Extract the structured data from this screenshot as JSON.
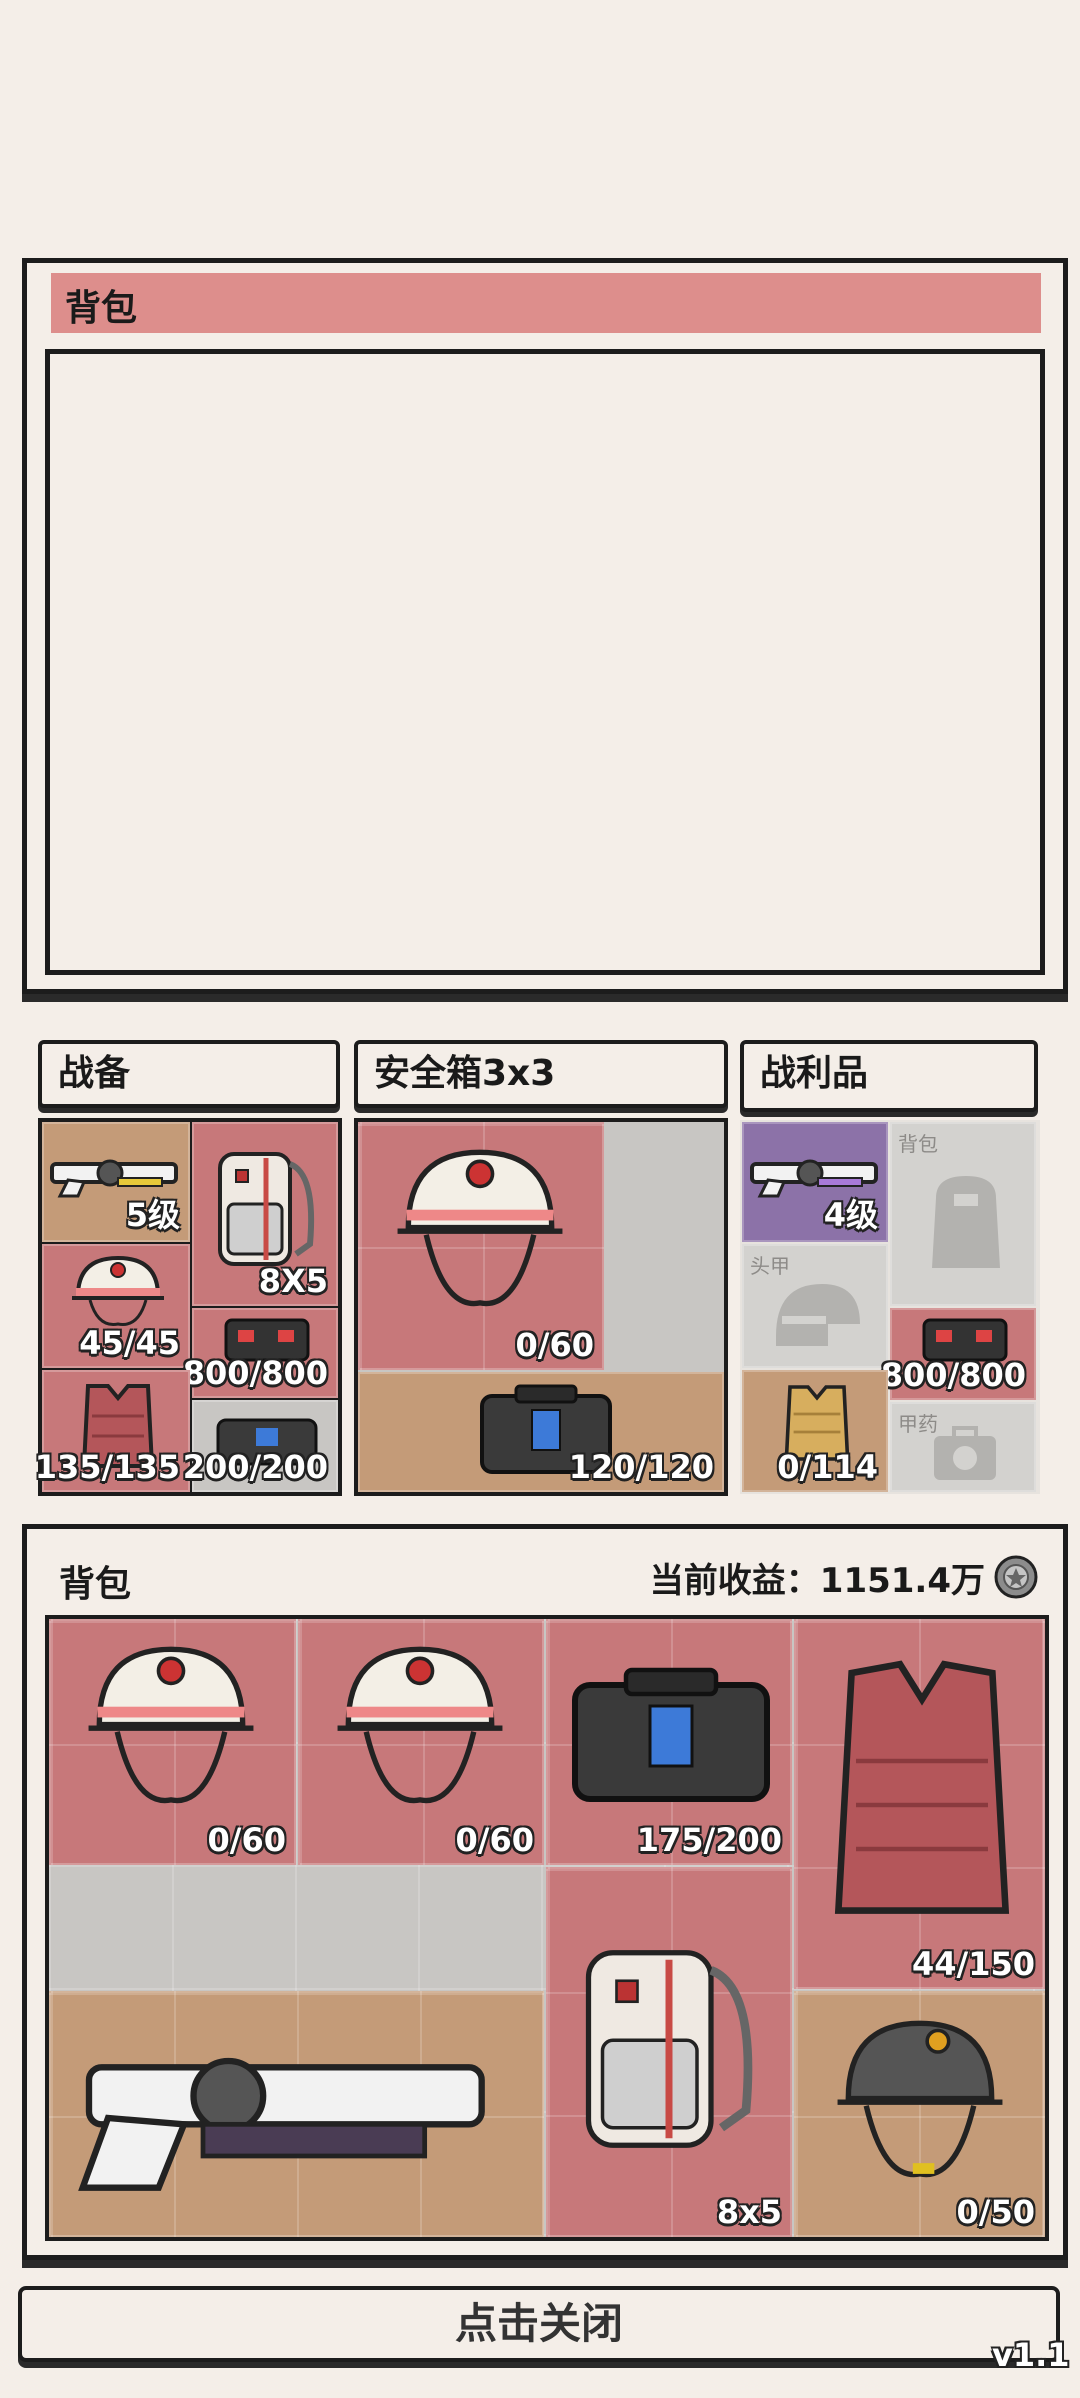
{
  "top_backpack": {
    "title": "背包"
  },
  "loadout": {
    "title": "战备",
    "weapon_level": "5级",
    "backpack_size": "8X5",
    "helmet_durability": "45/45",
    "chest_rig_capacity": "800/800",
    "armor_durability": "135/135",
    "bag_durability": "200/200"
  },
  "safebox": {
    "title": "安全箱3x3",
    "helmet_durability": "0/60",
    "bag_durability": "120/120"
  },
  "loot": {
    "title": "战利品",
    "weapon_level": "4级",
    "backpack_slot_label": "背包",
    "helmet_slot_label": "头甲",
    "chest_rig_capacity": "800/800",
    "armor_durability": "0/114",
    "medkit_slot_label": "甲药"
  },
  "main_backpack": {
    "title": "背包",
    "earnings_label": "当前收益：",
    "earnings_value": "1151.4万",
    "items": {
      "helmet_1": "0/60",
      "helmet_2": "0/60",
      "bag": "175/200",
      "armor": "44/150",
      "backpack": "8x5",
      "dark_helmet": "0/50"
    }
  },
  "close_button": "点击关闭",
  "version": "v1.1"
}
